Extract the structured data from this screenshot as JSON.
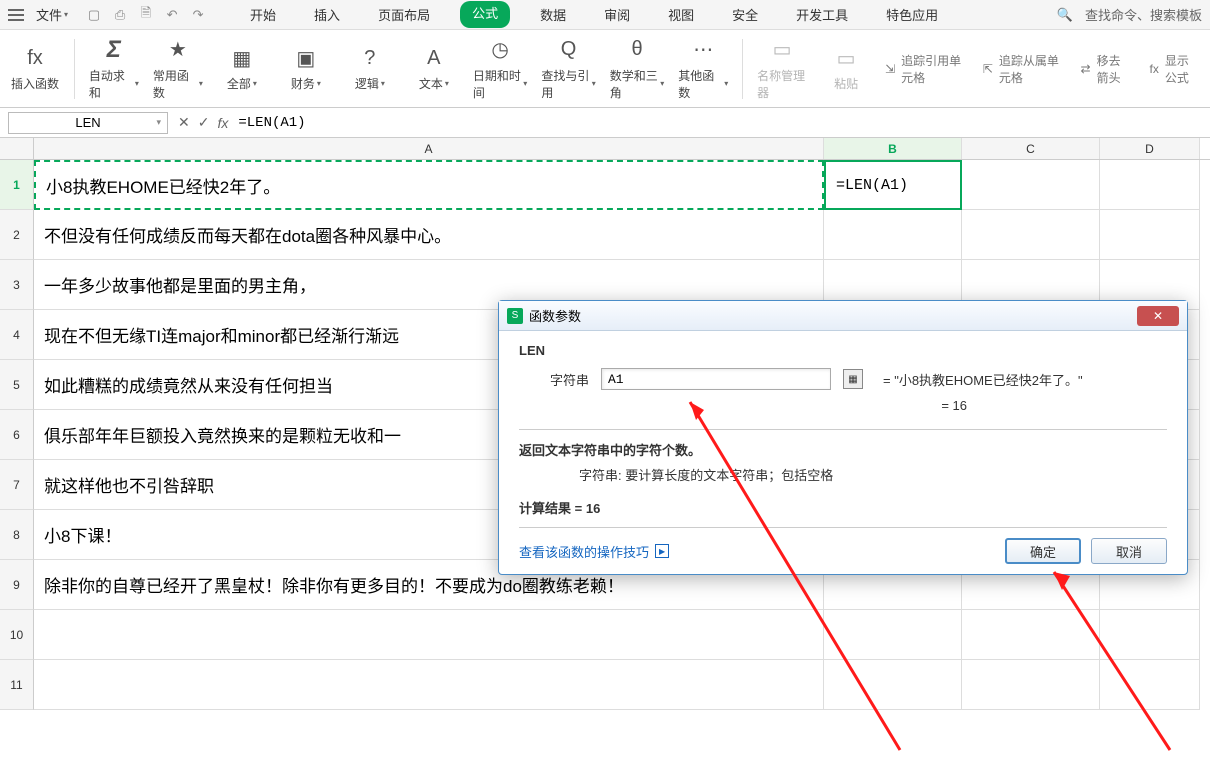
{
  "menubar": {
    "file": "文件",
    "tabs": [
      "开始",
      "插入",
      "页面布局",
      "公式",
      "数据",
      "审阅",
      "视图",
      "安全",
      "开发工具",
      "特色应用"
    ],
    "active_tab_index": 3,
    "search_placeholder": "查找命令、搜索模板"
  },
  "ribbon": {
    "groups": [
      {
        "icon": "fx",
        "label": "插入函数"
      },
      {
        "icon": "Σ",
        "label": "自动求和",
        "dd": true
      },
      {
        "icon": "★",
        "label": "常用函数",
        "dd": true
      },
      {
        "icon": "▦",
        "label": "全部",
        "dd": true
      },
      {
        "icon": "▣",
        "label": "财务",
        "dd": true
      },
      {
        "icon": "?",
        "label": "逻辑",
        "dd": true
      },
      {
        "icon": "A",
        "label": "文本",
        "dd": true
      },
      {
        "icon": "◷",
        "label": "日期和时间",
        "dd": true
      },
      {
        "icon": "Q",
        "label": "查找与引用",
        "dd": true
      },
      {
        "icon": "θ",
        "label": "数学和三角",
        "dd": true
      },
      {
        "icon": "⋯",
        "label": "其他函数",
        "dd": true
      },
      {
        "icon": "▭",
        "label": "名称管理器",
        "disabled": true
      },
      {
        "icon": "▭",
        "label": "粘贴",
        "disabled": true
      }
    ],
    "right_lines": [
      "追踪引用单元格",
      "追踪从属单元格",
      "移去箭头",
      "显示公式"
    ]
  },
  "formula_bar": {
    "name_box": "LEN",
    "formula": "=LEN(A1)"
  },
  "columns": [
    "A",
    "B",
    "C",
    "D"
  ],
  "rows": [
    {
      "n": 1,
      "A": "小8执教EHOME已经快2年了。",
      "B": "=LEN(A1)"
    },
    {
      "n": 2,
      "A": "不但没有任何成绩反而每天都在dota圈各种风暴中心。",
      "B": ""
    },
    {
      "n": 3,
      "A": "一年多少故事他都是里面的男主角，",
      "B": ""
    },
    {
      "n": 4,
      "A": "现在不但无缘TI连major和minor都已经渐行渐远",
      "B": ""
    },
    {
      "n": 5,
      "A": "如此糟糕的成绩竟然从来没有任何担当",
      "B": ""
    },
    {
      "n": 6,
      "A": "俱乐部年年巨额投入竟然换来的是颗粒无收和一",
      "B": ""
    },
    {
      "n": 7,
      "A": "就这样他也不引咎辞职",
      "B": ""
    },
    {
      "n": 8,
      "A": "小8下课！",
      "B": ""
    },
    {
      "n": 9,
      "A": "除非你的自尊已经开了黑皇杖！除非你有更多目的！不要成为do圈教练老赖！",
      "B": ""
    },
    {
      "n": 10,
      "A": "",
      "B": ""
    },
    {
      "n": 11,
      "A": "",
      "B": ""
    }
  ],
  "dialog": {
    "title": "函数参数",
    "fn": "LEN",
    "arg_label": "字符串",
    "arg_value": "A1",
    "arg_eval": "= \"小8执教EHOME已经快2年了。\"",
    "result_eq": "= 16",
    "desc1": "返回文本字符串中的字符个数。",
    "desc2_label": "字符串:",
    "desc2_text": "要计算长度的文本字符串；包括空格",
    "calc_result_label": "计算结果 =",
    "calc_result_value": "16",
    "help": "查看该函数的操作技巧",
    "ok": "确定",
    "cancel": "取消"
  }
}
